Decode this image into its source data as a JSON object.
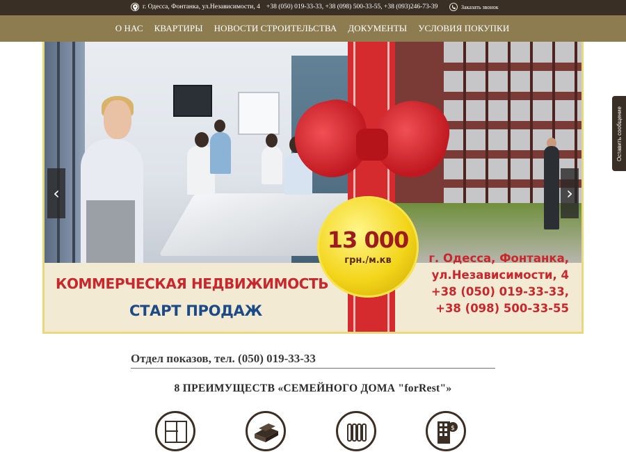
{
  "topbar": {
    "address": "г. Одесса, Фонтанка, ул.Независимости, 4",
    "phones": "+38 (050) 019-33-33, +38 (098) 500-33-55, +38 (093)246-73-39",
    "callback": "Заказать звонок",
    "pin_icon": "map-pin-icon",
    "phone_icon": "phone-icon"
  },
  "nav": {
    "items": [
      "О НАС",
      "КВАРТИРЫ",
      "НОВОСТИ СТРОИТЕЛЬСТВА",
      "ДОКУМЕНТЫ",
      "УСЛОВИЯ ПОКУПКИ"
    ]
  },
  "banner": {
    "price_value": "13 000",
    "price_unit": "грн./м.кв",
    "headline": "КОММЕРЧЕСКАЯ НЕДВИЖИМОСТЬ",
    "subheadline": "СТАРТ ПРОДАЖ",
    "address_line1": "г. Одесса, Фонтанка,",
    "address_line2": "ул.Независимости, 4",
    "phone1": "+38 (050) 019-33-33,",
    "phone2": "+38 (098) 500-33-55",
    "prev_arrow": "‹",
    "next_arrow": "›"
  },
  "sidetab": {
    "label": "Оставить сообщение"
  },
  "showroom": {
    "text": "Отдел показов, тел. (050) 019-33-33"
  },
  "advantages": {
    "title": "8 ПРЕИМУЩЕСТВ «СЕМЕЙНОГО ДОМА \"forRest\"»",
    "icons": [
      "floor-plan-icon",
      "bricks-icon",
      "radiator-icon",
      "building-money-icon"
    ]
  },
  "colors": {
    "topbar_bg": "#3a2f25",
    "nav_bg": "#8c7c50",
    "accent_red": "#c8272c",
    "accent_blue": "#1b4a86",
    "gold": "#f3d51a"
  }
}
